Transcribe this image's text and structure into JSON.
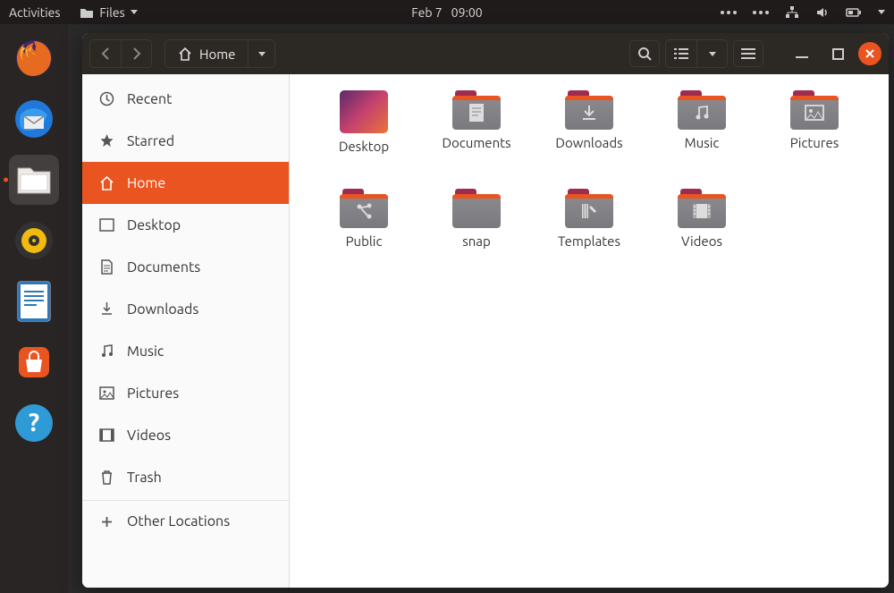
{
  "top_panel": {
    "activities": "Activities",
    "app_menu": "Files",
    "date": "Feb 7",
    "time": "09:00"
  },
  "titlebar": {
    "location": "Home"
  },
  "sidebar": {
    "items": [
      {
        "label": "Recent"
      },
      {
        "label": "Starred"
      },
      {
        "label": "Home"
      },
      {
        "label": "Desktop"
      },
      {
        "label": "Documents"
      },
      {
        "label": "Downloads"
      },
      {
        "label": "Music"
      },
      {
        "label": "Pictures"
      },
      {
        "label": "Videos"
      },
      {
        "label": "Trash"
      },
      {
        "label": "Other Locations"
      }
    ]
  },
  "content": {
    "items": [
      {
        "name": "Desktop"
      },
      {
        "name": "Documents"
      },
      {
        "name": "Downloads"
      },
      {
        "name": "Music"
      },
      {
        "name": "Pictures"
      },
      {
        "name": "Public"
      },
      {
        "name": "snap"
      },
      {
        "name": "Templates"
      },
      {
        "name": "Videos"
      }
    ]
  }
}
